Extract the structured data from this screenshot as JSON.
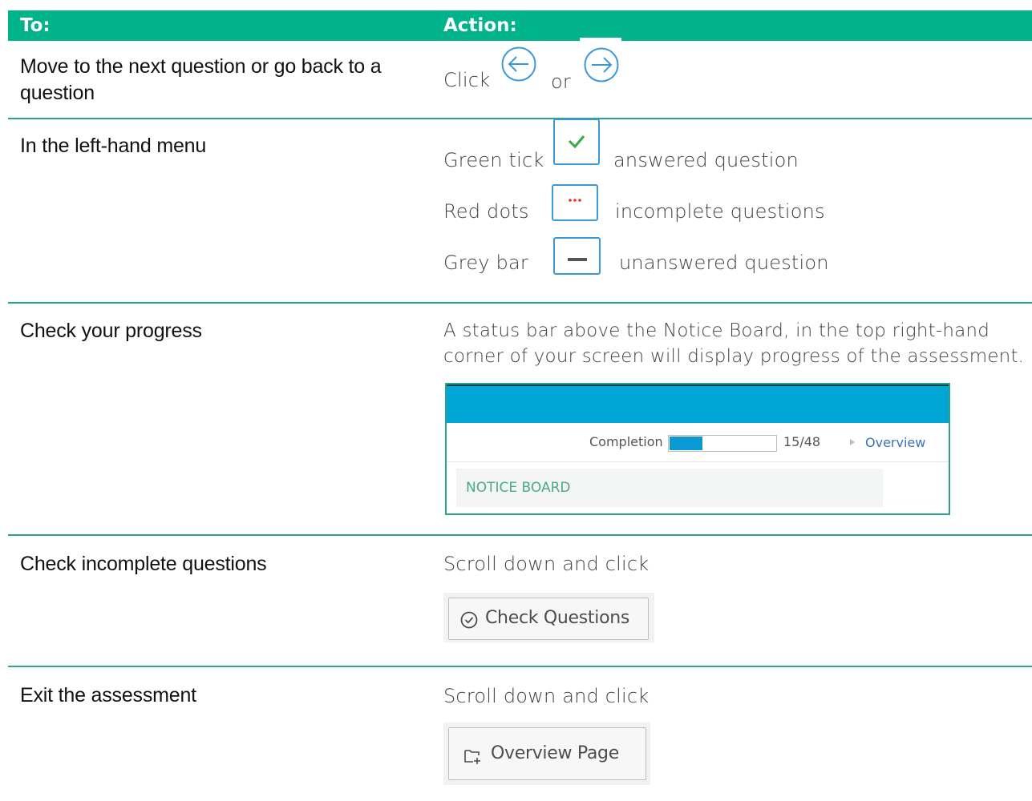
{
  "header": {
    "to_label": "To:",
    "action_label": "Action:"
  },
  "rows": {
    "navigate": {
      "to": "Move to the next question or go back to a question",
      "click_word": "Click",
      "or_word": "or",
      "icons": [
        "arrow-left-circle-icon",
        "arrow-right-circle-icon"
      ]
    },
    "menu": {
      "to": "In the left-hand menu",
      "items": [
        {
          "name": "Green tick",
          "desc": "answered question",
          "icon": "check-icon",
          "color": "#3aa845"
        },
        {
          "name": "Red dots",
          "desc": "incomplete questions",
          "icon": "dots-icon",
          "color": "#e8302b"
        },
        {
          "name": "Grey bar",
          "desc": "unanswered question",
          "icon": "bar-icon",
          "color": "#555555"
        }
      ]
    },
    "progress": {
      "to": "Check your progress",
      "line1": "A status bar above the Notice Board, in the top right-hand",
      "line2": "corner of your screen will display progress of the assessment.",
      "panel": {
        "completion_label": "Completion",
        "completed": 15,
        "total": 48,
        "count_text": "15/48",
        "overview_link": "Overview",
        "notice_board": "NOTICE BOARD",
        "bar_color": "#0a9ad3"
      }
    },
    "incomplete": {
      "to": "Check incomplete questions",
      "instruction": "Scroll down and click",
      "button_label": "Check Questions",
      "button_icon": "check-circle-icon"
    },
    "exit": {
      "to": "Exit the assessment",
      "instruction": "Scroll down and click",
      "button_label": "Overview Page",
      "button_icon": "folder-icon"
    }
  },
  "colors": {
    "header": "#00b38a",
    "divider": "#2aa58b",
    "icon_blue": "#3a9ad9"
  }
}
